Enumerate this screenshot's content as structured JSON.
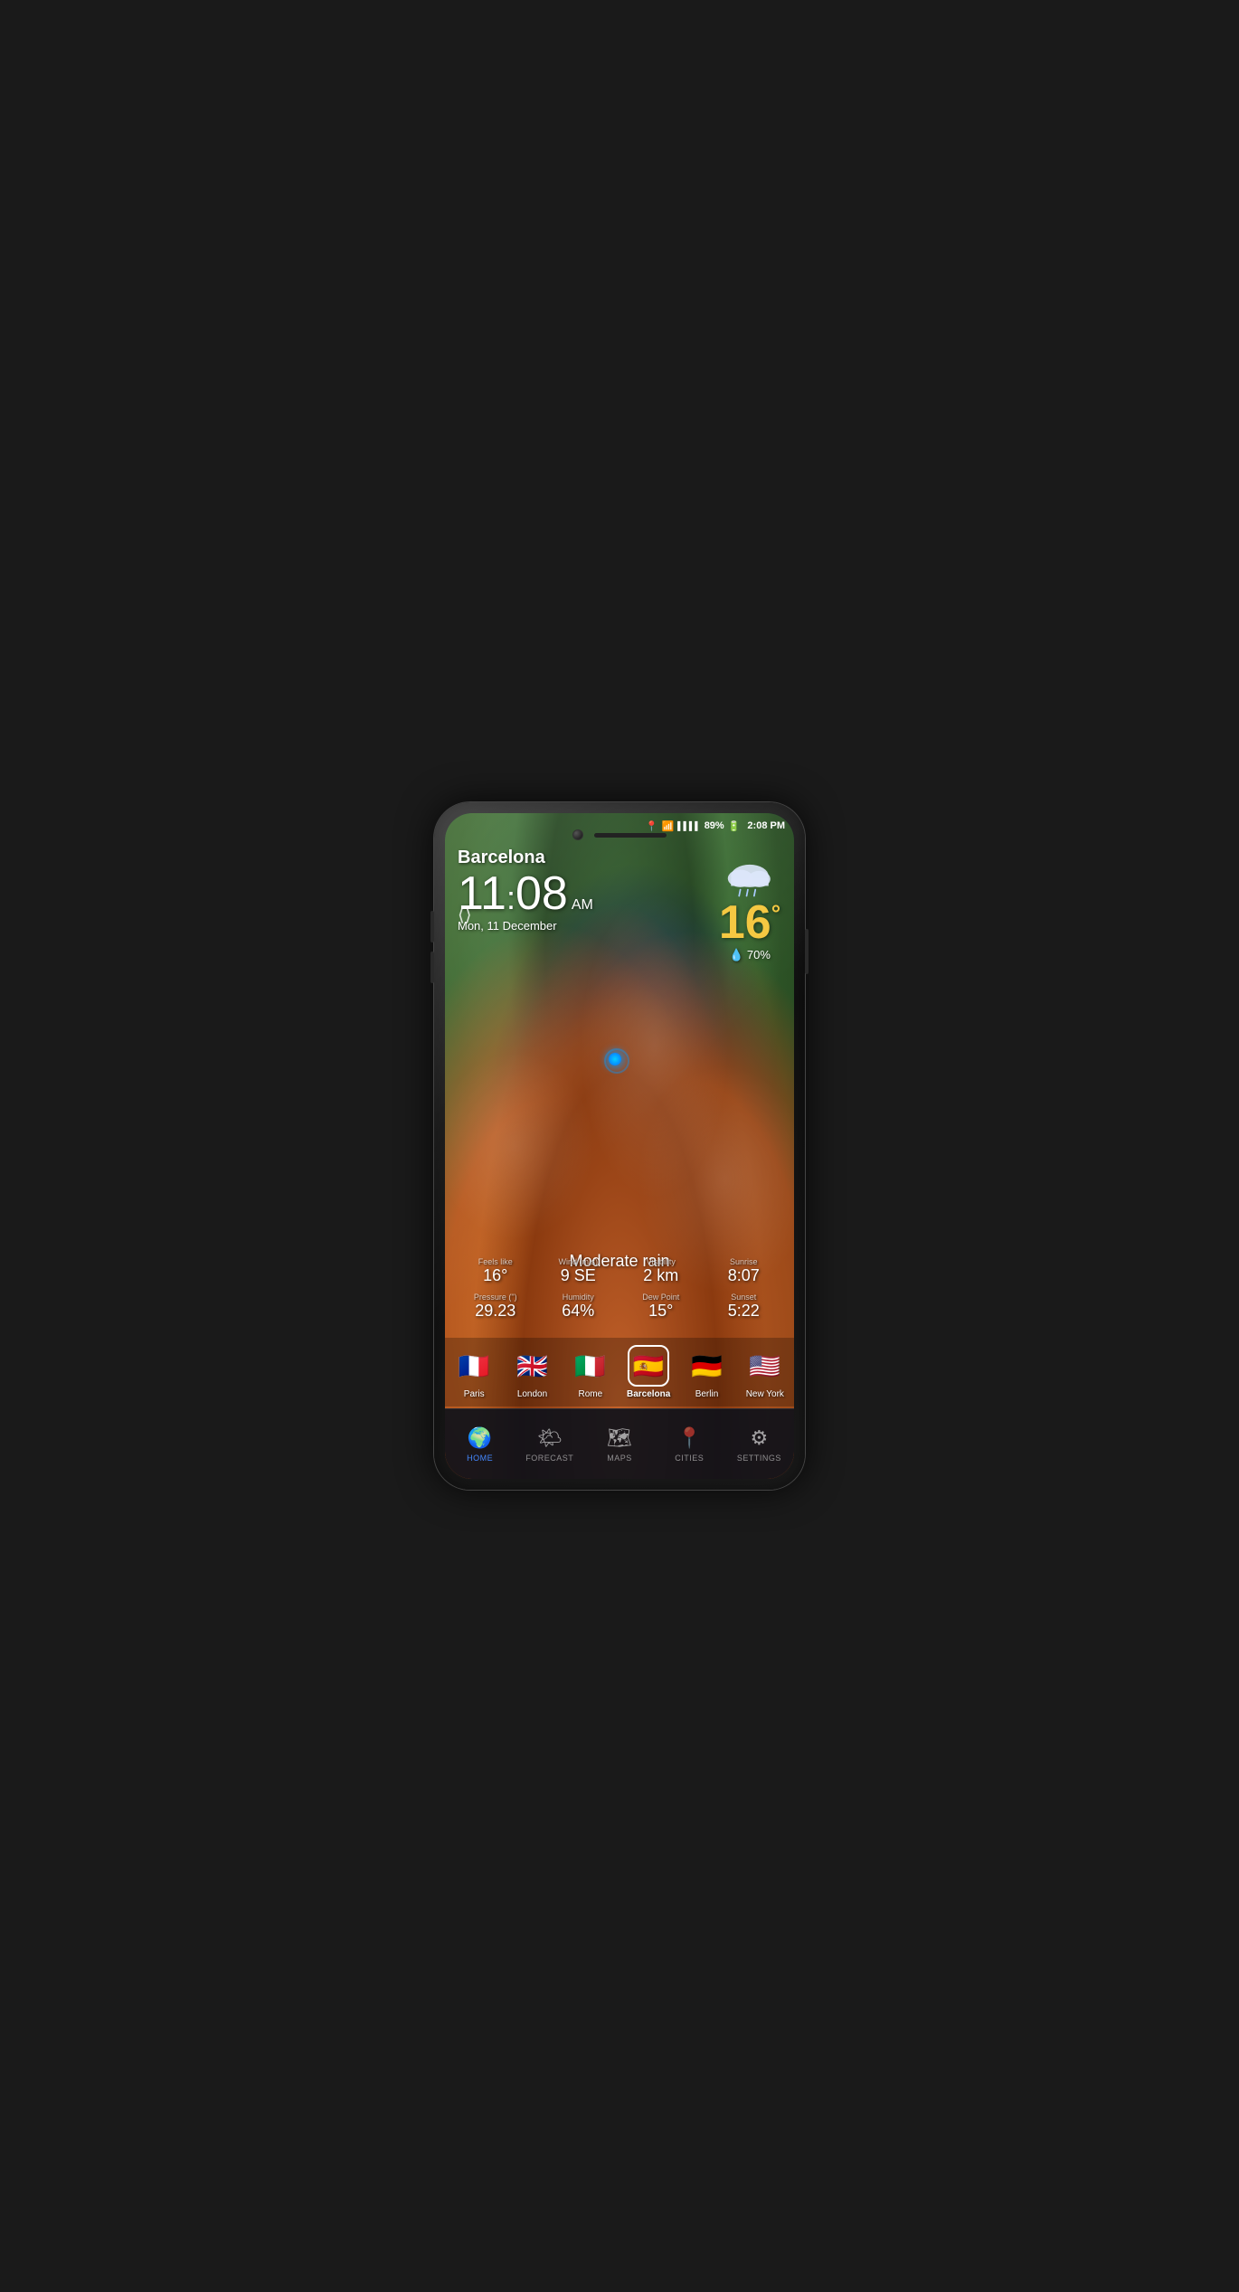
{
  "phone": {
    "status_bar": {
      "location_icon": "📍",
      "wifi_icon": "wifi",
      "signal_icon": "signal",
      "battery_percent": "89%",
      "battery_icon": "🔋",
      "time": "2:08 PM"
    },
    "weather": {
      "city": "Barcelona",
      "time_hour": "11",
      "time_min": "08",
      "time_ampm": "AM",
      "date": "Mon, 11 December",
      "temperature": "16",
      "temp_unit": "°",
      "humidity_label": "💧",
      "humidity_value": "70%",
      "condition": "Moderate rain",
      "stats": [
        {
          "label": "Feels like",
          "value": "16°"
        },
        {
          "label": "Wind (m/s)",
          "value": "9 SE"
        },
        {
          "label": "Visibility",
          "value": "2 km"
        },
        {
          "label": "Sunrise",
          "value": "8:07"
        },
        {
          "label": "Pressure (\")",
          "value": "29.23"
        },
        {
          "label": "Humidity",
          "value": "64%"
        },
        {
          "label": "Dew Point",
          "value": "15°"
        },
        {
          "label": "Sunset",
          "value": "5:22"
        }
      ]
    },
    "cities": [
      {
        "flag": "🇫🇷",
        "name": "Paris",
        "active": false
      },
      {
        "flag": "🇬🇧",
        "name": "London",
        "active": false
      },
      {
        "flag": "🇮🇹",
        "name": "Rome",
        "active": false
      },
      {
        "flag": "🇪🇸",
        "name": "Barcelona",
        "active": true
      },
      {
        "flag": "🇩🇪",
        "name": "Berlin",
        "active": false
      },
      {
        "flag": "🇺🇸",
        "name": "New York",
        "active": false
      }
    ],
    "nav": [
      {
        "icon": "🌍",
        "label": "HOME",
        "active": true
      },
      {
        "icon": "🌤",
        "label": "FORECAST",
        "active": false
      },
      {
        "icon": "🗺",
        "label": "MAPS",
        "active": false
      },
      {
        "icon": "📍",
        "label": "CITIES",
        "active": false
      },
      {
        "icon": "⚙",
        "label": "SETTINGS",
        "active": false
      }
    ]
  }
}
